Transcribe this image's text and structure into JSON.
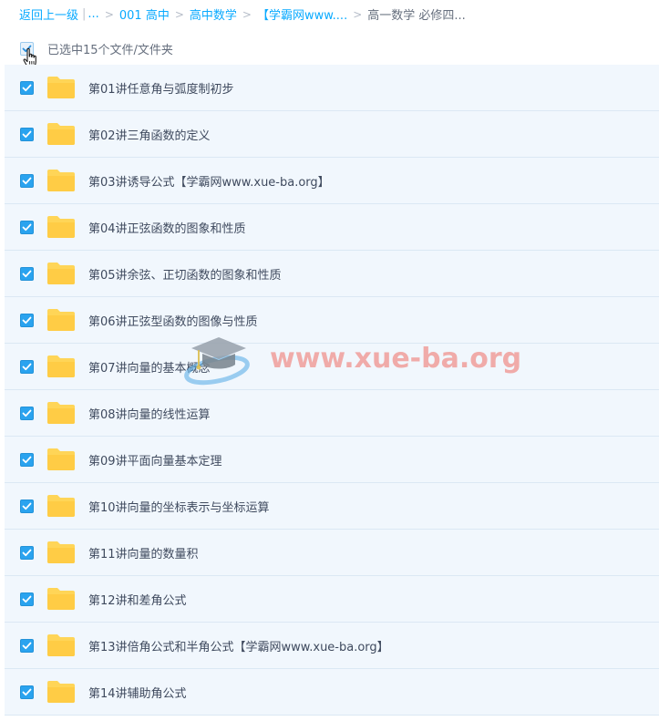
{
  "breadcrumb": {
    "back": "返回上一级",
    "ellipsis": "...",
    "crumbs": [
      "001 高中",
      "高中数学",
      "【学霸网www...."
    ],
    "current": "高一数学 必修四..."
  },
  "selection": {
    "text": "已选中15个文件/文件夹"
  },
  "files": [
    "第01讲任意角与弧度制初步",
    "第02讲三角函数的定义",
    "第03讲诱导公式【学霸网www.xue-ba.org】",
    "第04讲正弦函数的图象和性质",
    "第05讲余弦、正切函数的图象和性质",
    "第06讲正弦型函数的图像与性质",
    "第07讲向量的基本概念",
    "第08讲向量的线性运算",
    "第09讲平面向量基本定理",
    "第10讲向量的坐标表示与坐标运算",
    "第11讲向量的数量积",
    "第12讲和差角公式",
    "第13讲倍角公式和半角公式【学霸网www.xue-ba.org】",
    "第14讲辅助角公式"
  ],
  "watermark": {
    "text": "www.xue-ba.org"
  },
  "colors": {
    "link": "#09aaff",
    "checkbox": "#2aa3ef",
    "folder": "#ffd557",
    "row_bg": "#f1f7fd"
  }
}
